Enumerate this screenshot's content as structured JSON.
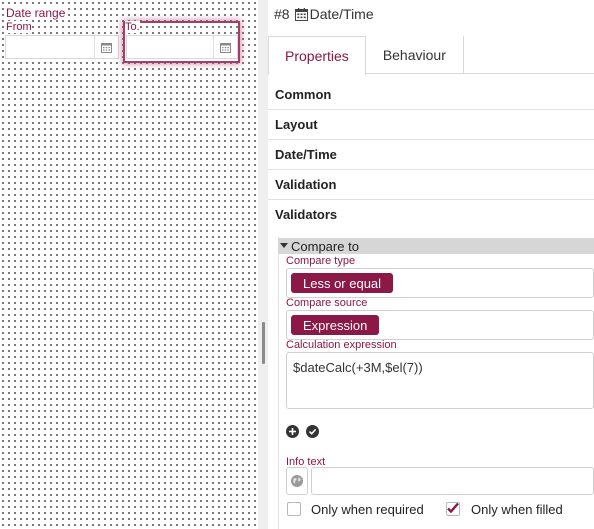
{
  "canvas": {
    "group_label": "Date range",
    "from_label": "From",
    "to_label": "To."
  },
  "panel": {
    "element_number": "#8",
    "element_icon": "calendar-icon",
    "element_type": "Date/Time",
    "tabs": [
      {
        "label": "Properties",
        "active": true
      },
      {
        "label": "Behaviour",
        "active": false
      }
    ],
    "sections": [
      "Common",
      "Layout",
      "Date/Time",
      "Validation",
      "Validators"
    ],
    "validator": {
      "title": "Compare to",
      "compare_type_label": "Compare type",
      "compare_type_value": "Less or equal",
      "compare_source_label": "Compare source",
      "compare_source_value": "Expression",
      "calc_expression_label": "Calculation expression",
      "calc_expression_value": "$dateCalc(+3M,$el(7))",
      "info_text_label": "Info text",
      "info_text_value": "",
      "only_when_required_label": "Only when required",
      "only_when_required_checked": false,
      "only_when_filled_label": "Only when filled",
      "only_when_filled_checked": true
    }
  },
  "colors": {
    "accent": "#8b1846",
    "selection_border": "#a43d6a",
    "section_header_bg": "#d6d6d6"
  }
}
